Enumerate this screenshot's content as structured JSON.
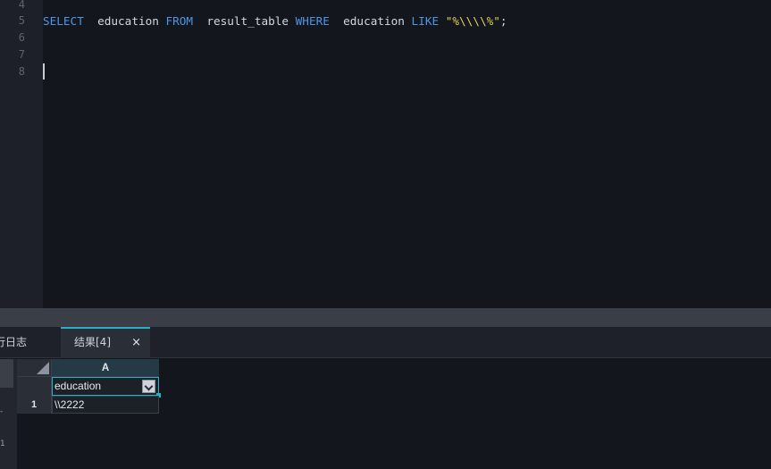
{
  "editor": {
    "line_numbers": [
      "4",
      "5",
      "6",
      "7",
      "8"
    ],
    "sql": {
      "kw_select": "SELECT",
      "col": "education",
      "kw_from": "FROM",
      "table": "result_table",
      "kw_where": "WHERE",
      "col2": "education",
      "kw_like": "LIKE",
      "pattern": "\"%\\\\\\\\%\"",
      "terminator": ";"
    }
  },
  "tabs": {
    "log_label": "行日志",
    "result_label": "结果[4]",
    "close_glyph": "×"
  },
  "grid": {
    "column_letter": "A",
    "field_name": "education",
    "rows": [
      {
        "index": "1",
        "value": "\\\\2222"
      }
    ]
  },
  "side_strip": {
    "glyphs": [
      "-",
      "1"
    ]
  },
  "colors": {
    "keyword": "#4e95e6",
    "string": "#e2d05b",
    "accent": "#2ab0c6"
  }
}
